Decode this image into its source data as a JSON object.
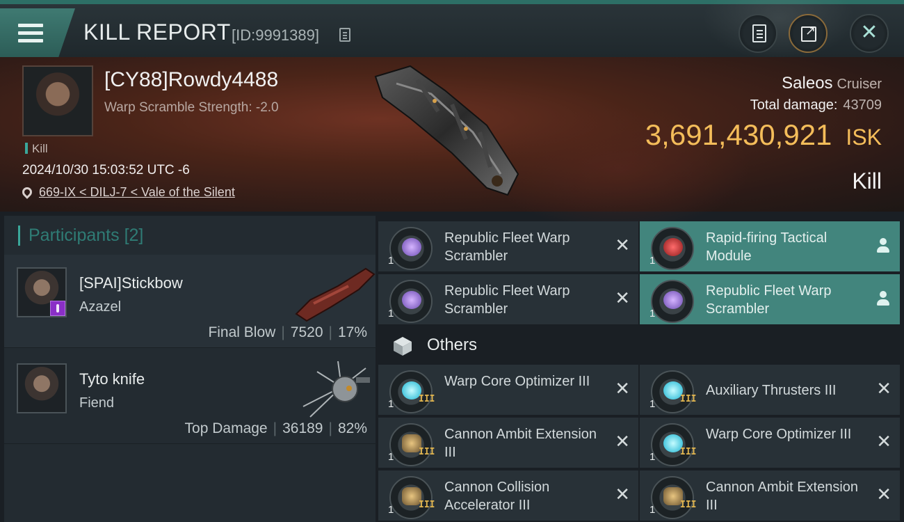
{
  "header": {
    "title": "KILL REPORT",
    "id_label": "[ID:9991389]"
  },
  "victim": {
    "name": "[CY88]Rowdy4488",
    "subtitle": "Warp Scramble Strength: -2.0",
    "tag": "Kill",
    "timestamp": "2024/10/30 15:03:52 UTC -6",
    "location": "669-IX < DILJ-7 < Vale of the Silent",
    "ship_name": "Saleos",
    "ship_class": "Cruiser",
    "damage_label": "Total damage:",
    "damage_value": "43709",
    "isk_value": "3,691,430,921",
    "isk_unit": "ISK",
    "result": "Kill"
  },
  "participants": {
    "title": "Participants",
    "count": "[2]",
    "items": [
      {
        "name": "[SPAI]Stickbow",
        "ship": "Azazel",
        "role": "Final Blow",
        "damage": "7520",
        "percent": "17%"
      },
      {
        "name": "Tyto knife",
        "ship": "Fiend",
        "role": "Top Damage",
        "damage": "36189",
        "percent": "82%"
      }
    ]
  },
  "modules": {
    "others_label": "Others",
    "top": [
      {
        "label": "Republic Fleet Warp Scrambler",
        "qty": "1",
        "state": "destroyed"
      },
      {
        "label": "Rapid-firing Tactical Module",
        "qty": "1",
        "state": "dropped"
      },
      {
        "label": "Republic Fleet Warp Scrambler",
        "qty": "1",
        "state": "destroyed"
      },
      {
        "label": "Republic Fleet Warp Scrambler",
        "qty": "1",
        "state": "dropped"
      }
    ],
    "others": [
      {
        "label": "Warp Core Optimizer III",
        "qty": "1",
        "state": "destroyed"
      },
      {
        "label": "Auxiliary Thrusters III",
        "qty": "1",
        "state": "destroyed"
      },
      {
        "label": "Cannon Ambit Extension III",
        "qty": "1",
        "state": "destroyed"
      },
      {
        "label": "Warp Core Optimizer III",
        "qty": "1",
        "state": "destroyed"
      },
      {
        "label": "Cannon Collision Accelerator III",
        "qty": "1",
        "state": "destroyed"
      },
      {
        "label": "Cannon Ambit Extension III",
        "qty": "1",
        "state": "destroyed"
      }
    ]
  },
  "colors": {
    "accent": "#3aa79a",
    "highlight_row": "#42857d",
    "isk_gold": "#f4bd5a"
  }
}
